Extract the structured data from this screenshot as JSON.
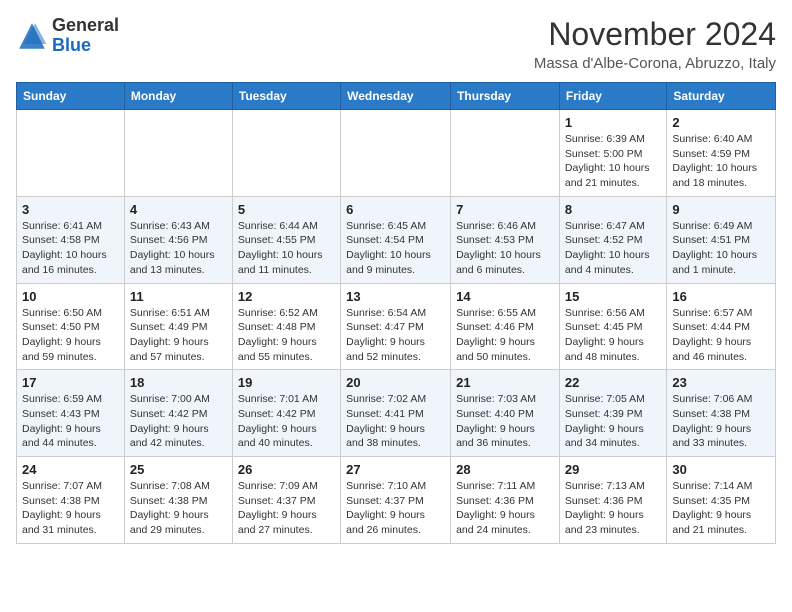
{
  "header": {
    "logo_general": "General",
    "logo_blue": "Blue",
    "month_title": "November 2024",
    "location": "Massa d'Albe-Corona, Abruzzo, Italy"
  },
  "days_of_week": [
    "Sunday",
    "Monday",
    "Tuesday",
    "Wednesday",
    "Thursday",
    "Friday",
    "Saturday"
  ],
  "weeks": [
    [
      {
        "day": "",
        "info": ""
      },
      {
        "day": "",
        "info": ""
      },
      {
        "day": "",
        "info": ""
      },
      {
        "day": "",
        "info": ""
      },
      {
        "day": "",
        "info": ""
      },
      {
        "day": "1",
        "info": "Sunrise: 6:39 AM\nSunset: 5:00 PM\nDaylight: 10 hours\nand 21 minutes."
      },
      {
        "day": "2",
        "info": "Sunrise: 6:40 AM\nSunset: 4:59 PM\nDaylight: 10 hours\nand 18 minutes."
      }
    ],
    [
      {
        "day": "3",
        "info": "Sunrise: 6:41 AM\nSunset: 4:58 PM\nDaylight: 10 hours\nand 16 minutes."
      },
      {
        "day": "4",
        "info": "Sunrise: 6:43 AM\nSunset: 4:56 PM\nDaylight: 10 hours\nand 13 minutes."
      },
      {
        "day": "5",
        "info": "Sunrise: 6:44 AM\nSunset: 4:55 PM\nDaylight: 10 hours\nand 11 minutes."
      },
      {
        "day": "6",
        "info": "Sunrise: 6:45 AM\nSunset: 4:54 PM\nDaylight: 10 hours\nand 9 minutes."
      },
      {
        "day": "7",
        "info": "Sunrise: 6:46 AM\nSunset: 4:53 PM\nDaylight: 10 hours\nand 6 minutes."
      },
      {
        "day": "8",
        "info": "Sunrise: 6:47 AM\nSunset: 4:52 PM\nDaylight: 10 hours\nand 4 minutes."
      },
      {
        "day": "9",
        "info": "Sunrise: 6:49 AM\nSunset: 4:51 PM\nDaylight: 10 hours\nand 1 minute."
      }
    ],
    [
      {
        "day": "10",
        "info": "Sunrise: 6:50 AM\nSunset: 4:50 PM\nDaylight: 9 hours\nand 59 minutes."
      },
      {
        "day": "11",
        "info": "Sunrise: 6:51 AM\nSunset: 4:49 PM\nDaylight: 9 hours\nand 57 minutes."
      },
      {
        "day": "12",
        "info": "Sunrise: 6:52 AM\nSunset: 4:48 PM\nDaylight: 9 hours\nand 55 minutes."
      },
      {
        "day": "13",
        "info": "Sunrise: 6:54 AM\nSunset: 4:47 PM\nDaylight: 9 hours\nand 52 minutes."
      },
      {
        "day": "14",
        "info": "Sunrise: 6:55 AM\nSunset: 4:46 PM\nDaylight: 9 hours\nand 50 minutes."
      },
      {
        "day": "15",
        "info": "Sunrise: 6:56 AM\nSunset: 4:45 PM\nDaylight: 9 hours\nand 48 minutes."
      },
      {
        "day": "16",
        "info": "Sunrise: 6:57 AM\nSunset: 4:44 PM\nDaylight: 9 hours\nand 46 minutes."
      }
    ],
    [
      {
        "day": "17",
        "info": "Sunrise: 6:59 AM\nSunset: 4:43 PM\nDaylight: 9 hours\nand 44 minutes."
      },
      {
        "day": "18",
        "info": "Sunrise: 7:00 AM\nSunset: 4:42 PM\nDaylight: 9 hours\nand 42 minutes."
      },
      {
        "day": "19",
        "info": "Sunrise: 7:01 AM\nSunset: 4:42 PM\nDaylight: 9 hours\nand 40 minutes."
      },
      {
        "day": "20",
        "info": "Sunrise: 7:02 AM\nSunset: 4:41 PM\nDaylight: 9 hours\nand 38 minutes."
      },
      {
        "day": "21",
        "info": "Sunrise: 7:03 AM\nSunset: 4:40 PM\nDaylight: 9 hours\nand 36 minutes."
      },
      {
        "day": "22",
        "info": "Sunrise: 7:05 AM\nSunset: 4:39 PM\nDaylight: 9 hours\nand 34 minutes."
      },
      {
        "day": "23",
        "info": "Sunrise: 7:06 AM\nSunset: 4:38 PM\nDaylight: 9 hours\nand 33 minutes."
      }
    ],
    [
      {
        "day": "24",
        "info": "Sunrise: 7:07 AM\nSunset: 4:38 PM\nDaylight: 9 hours\nand 31 minutes."
      },
      {
        "day": "25",
        "info": "Sunrise: 7:08 AM\nSunset: 4:38 PM\nDaylight: 9 hours\nand 29 minutes."
      },
      {
        "day": "26",
        "info": "Sunrise: 7:09 AM\nSunset: 4:37 PM\nDaylight: 9 hours\nand 27 minutes."
      },
      {
        "day": "27",
        "info": "Sunrise: 7:10 AM\nSunset: 4:37 PM\nDaylight: 9 hours\nand 26 minutes."
      },
      {
        "day": "28",
        "info": "Sunrise: 7:11 AM\nSunset: 4:36 PM\nDaylight: 9 hours\nand 24 minutes."
      },
      {
        "day": "29",
        "info": "Sunrise: 7:13 AM\nSunset: 4:36 PM\nDaylight: 9 hours\nand 23 minutes."
      },
      {
        "day": "30",
        "info": "Sunrise: 7:14 AM\nSunset: 4:35 PM\nDaylight: 9 hours\nand 21 minutes."
      }
    ]
  ]
}
